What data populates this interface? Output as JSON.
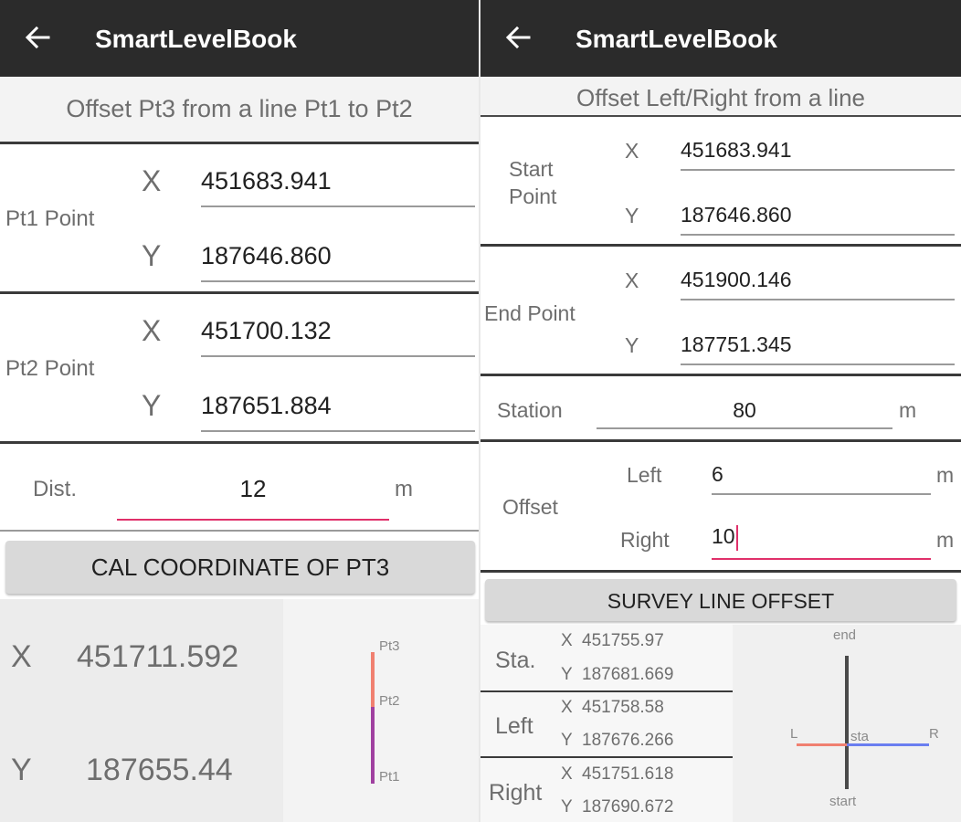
{
  "left_screen": {
    "app_title": "SmartLevelBook",
    "subtitle": "Offset Pt3 from a line Pt1 to Pt2",
    "pt1": {
      "label": "Pt1 Point",
      "x_label": "X",
      "x_value": "451683.941",
      "y_label": "Y",
      "y_value": "187646.860"
    },
    "pt2": {
      "label": "Pt2 Point",
      "x_label": "X",
      "x_value": "451700.132",
      "y_label": "Y",
      "y_value": "187651.884"
    },
    "dist": {
      "label": "Dist.",
      "value": "12",
      "unit": "m"
    },
    "button_label": "CAL COORDINATE OF PT3",
    "result": {
      "x_label": "X",
      "x_value": "451711.592",
      "y_label": "Y",
      "y_value": "187655.44"
    },
    "diagram": {
      "pt3": "Pt3",
      "pt2": "Pt2",
      "pt1": "Pt1"
    }
  },
  "right_screen": {
    "app_title": "SmartLevelBook",
    "subtitle": "Offset Left/Right from a line",
    "start": {
      "label_line1": "Start",
      "label_line2": "Point",
      "x_label": "X",
      "x_value": "451683.941",
      "y_label": "Y",
      "y_value": "187646.860"
    },
    "end": {
      "label": "End Point",
      "x_label": "X",
      "x_value": "451900.146",
      "y_label": "Y",
      "y_value": "187751.345"
    },
    "station": {
      "label": "Station",
      "value": "80",
      "unit": "m"
    },
    "offset": {
      "label": "Offset",
      "left_label": "Left",
      "left_value": "6",
      "left_unit": "m",
      "right_label": "Right",
      "right_value": "10",
      "right_unit": "m"
    },
    "button_label": "SURVEY LINE OFFSET",
    "results": [
      {
        "label": "Sta.",
        "x_label": "X",
        "x": "451755.97",
        "y_label": "Y",
        "y": "187681.669"
      },
      {
        "label": "Left",
        "x_label": "X",
        "x": "451758.58",
        "y_label": "Y",
        "y": "187676.266"
      },
      {
        "label": "Right",
        "x_label": "X",
        "x": "451751.618",
        "y_label": "Y",
        "y": "187690.672"
      }
    ],
    "diagram": {
      "end": "end",
      "start": "start",
      "l": "L",
      "r": "R",
      "sta": "sta"
    }
  },
  "colors": {
    "appbar": "#2b2b2b",
    "accent_pink": "#e0306a",
    "salmon": "#f08070",
    "purple": "#a040a0",
    "blue": "#6a7ef0"
  }
}
